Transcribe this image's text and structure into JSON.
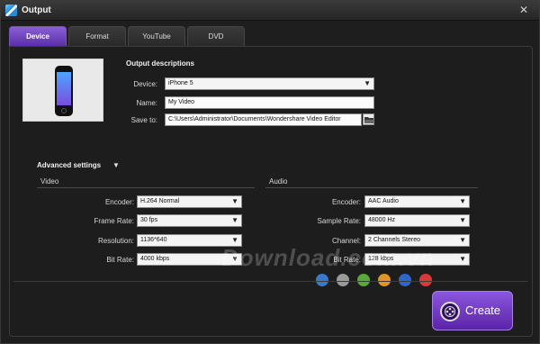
{
  "window": {
    "title": "Output",
    "close_glyph": "✕"
  },
  "tabs": [
    {
      "label": "Device",
      "active": true
    },
    {
      "label": "Format",
      "active": false
    },
    {
      "label": "YouTube",
      "active": false
    },
    {
      "label": "DVD",
      "active": false
    }
  ],
  "output": {
    "title": "Output descriptions",
    "device_label": "Device:",
    "device_value": "iPhone 5",
    "name_label": "Name:",
    "name_value": "My Video",
    "save_label": "Save to:",
    "save_value": "C:\\Users\\Administrator\\Documents\\Wondershare Video Editor"
  },
  "advanced": {
    "title": "Advanced settings",
    "arrow": "▼",
    "video": {
      "header": "Video",
      "encoder_label": "Encoder:",
      "encoder_value": "H.264 Normal",
      "framerate_label": "Frame Rate:",
      "framerate_value": "30 fps",
      "resolution_label": "Resolution:",
      "resolution_value": "1136*640",
      "bitrate_label": "Bit Rate:",
      "bitrate_value": "4000 kbps"
    },
    "audio": {
      "header": "Audio",
      "encoder_label": "Encoder:",
      "encoder_value": "AAC Audio",
      "samplerate_label": "Sample Rate:",
      "samplerate_value": "48000 Hz",
      "channel_label": "Channel:",
      "channel_value": "2 Channels Stereo",
      "bitrate_label": "Bit Rate:",
      "bitrate_value": "128 kbps"
    }
  },
  "create_label": "Create",
  "watermark": {
    "text": "Download.com.vn",
    "dot_colors": [
      "#3a78c8",
      "#9a9a9a",
      "#5aa83a",
      "#e0952a",
      "#2f66c8",
      "#d83a3a"
    ]
  },
  "colors": {
    "accent": "#6a3cc0",
    "background": "#1e1e1e"
  }
}
